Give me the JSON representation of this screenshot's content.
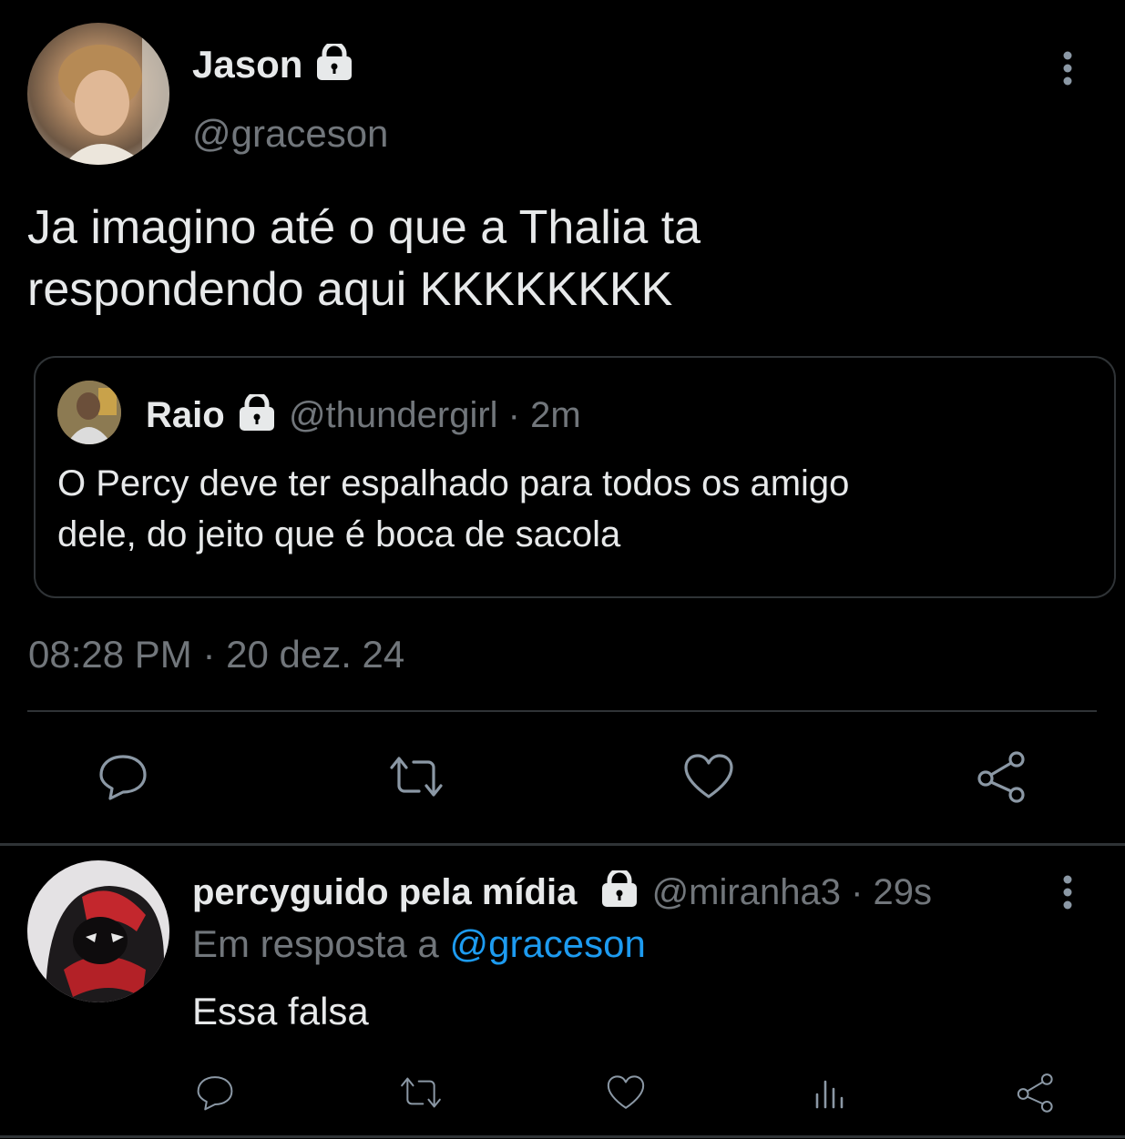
{
  "tweet": {
    "author_name": "Jason",
    "author_handle": "@graceson",
    "text_line1": "Ja imagino até o que a Thalia ta",
    "text_line2": "respondendo aqui KKKKKKKK",
    "quote": {
      "author_name": "Raio",
      "author_handle": "@thundergirl",
      "separator": "·",
      "time": "2m",
      "text_line1": "O Percy deve ter espalhado para todos os amigo",
      "text_line2": "dele, do jeito que é boca de sacola"
    },
    "timestamp": "08:28 PM · 20 dez. 24",
    "actions": [
      "reply-icon",
      "retweet-icon",
      "like-icon",
      "share-icon"
    ]
  },
  "reply": {
    "author_name": "percyguido pela mídia",
    "author_handle": "@miranha3",
    "separator": "·",
    "time": "29s",
    "in_reply_prefix": "Em resposta a",
    "in_reply_handle": "@graceson",
    "text": "Essa falsa",
    "actions": [
      "reply-icon",
      "retweet-icon",
      "like-icon",
      "views-icon",
      "share-icon"
    ]
  },
  "colors": {
    "background": "#000000",
    "text": "#e7e9ea",
    "muted": "#71767b",
    "link": "#1d9bf0",
    "divider": "#2f3336"
  }
}
